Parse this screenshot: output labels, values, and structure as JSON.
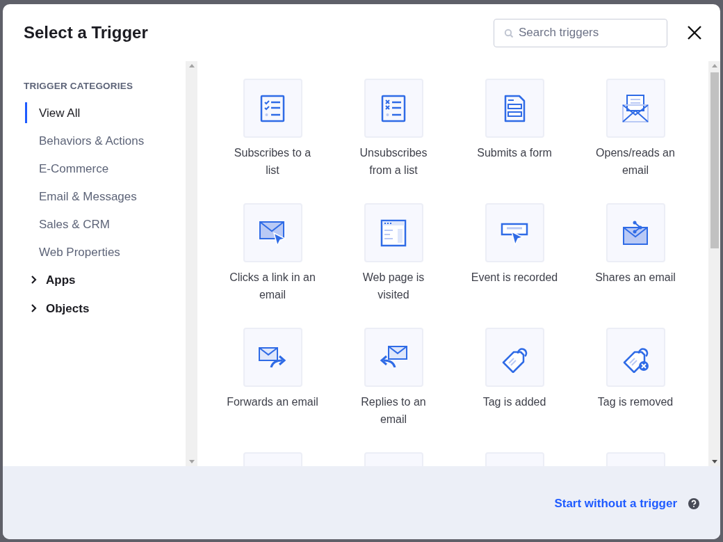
{
  "dialog": {
    "title": "Select a Trigger"
  },
  "search": {
    "placeholder": "Search triggers"
  },
  "sidebar": {
    "heading": "TRIGGER CATEGORIES",
    "categories": [
      {
        "label": "View All",
        "selected": true
      },
      {
        "label": "Behaviors & Actions",
        "selected": false
      },
      {
        "label": "E-Commerce",
        "selected": false
      },
      {
        "label": "Email & Messages",
        "selected": false
      },
      {
        "label": "Sales & CRM",
        "selected": false
      },
      {
        "label": "Web Properties",
        "selected": false
      }
    ],
    "groups": [
      {
        "label": "Apps",
        "expanded": false
      },
      {
        "label": "Objects",
        "expanded": false
      }
    ]
  },
  "triggers": [
    {
      "label": "Subscribes to a list",
      "kind": "list-check"
    },
    {
      "label": "Unsubscribes from a list",
      "kind": "list-x"
    },
    {
      "label": "Submits a form",
      "kind": "form"
    },
    {
      "label": "Opens/reads an email",
      "kind": "email-open"
    },
    {
      "label": "Clicks a link in an email",
      "kind": "email-click"
    },
    {
      "label": "Web page is visited",
      "kind": "webpage"
    },
    {
      "label": "Event is recorded",
      "kind": "event"
    },
    {
      "label": "Shares an email",
      "kind": "email-share"
    },
    {
      "label": "Forwards an email",
      "kind": "email-forward"
    },
    {
      "label": "Replies to an email",
      "kind": "email-reply"
    },
    {
      "label": "Tag is added",
      "kind": "tag-add"
    },
    {
      "label": "Tag is removed",
      "kind": "tag-remove"
    }
  ],
  "footer": {
    "link": "Start without a trigger"
  }
}
